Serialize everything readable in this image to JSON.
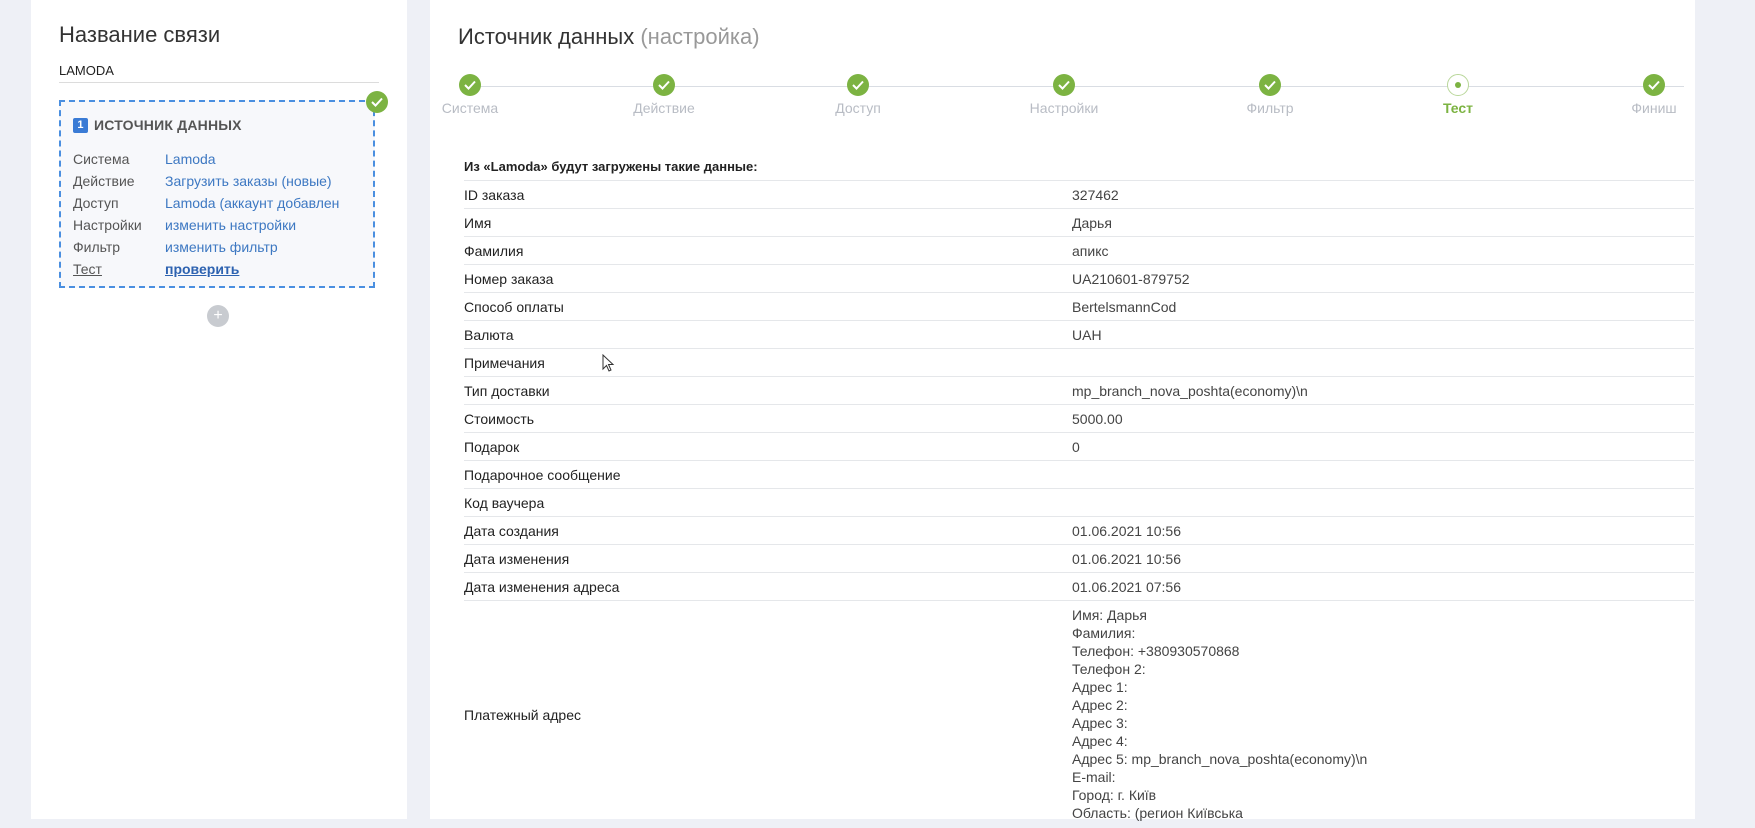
{
  "left": {
    "title": "Название связи",
    "connection_name": "LAMODA",
    "card": {
      "number": "1",
      "header": "ИСТОЧНИК ДАННЫХ",
      "rows": [
        {
          "label": "Система",
          "value": "Lamoda"
        },
        {
          "label": "Действие",
          "value": "Загрузить заказы (новые)"
        },
        {
          "label": "Доступ",
          "value": "Lamoda (аккаунт добавлен"
        },
        {
          "label": "Настройки",
          "value": "изменить настройки"
        },
        {
          "label": "Фильтр",
          "value": "изменить фильтр"
        },
        {
          "label": "Тест",
          "value": "проверить"
        }
      ]
    },
    "add_label": "+"
  },
  "main": {
    "title": "Источник данных",
    "title_sub": "(настройка)",
    "steps": [
      {
        "label": "Система",
        "state": "done"
      },
      {
        "label": "Действие",
        "state": "done"
      },
      {
        "label": "Доступ",
        "state": "done"
      },
      {
        "label": "Настройки",
        "state": "done"
      },
      {
        "label": "Фильтр",
        "state": "done"
      },
      {
        "label": "Тест",
        "state": "current"
      },
      {
        "label": "Финиш",
        "state": "done"
      }
    ],
    "data_heading": "Из «Lamoda» будут загружены такие данные:",
    "rows": [
      {
        "key": "ID заказа",
        "value": "327462"
      },
      {
        "key": "Имя",
        "value": "Дарья"
      },
      {
        "key": "Фамилия",
        "value": "апикс"
      },
      {
        "key": "Номер заказа",
        "value": "UA210601-879752"
      },
      {
        "key": "Способ оплаты",
        "value": "BertelsmannCod"
      },
      {
        "key": "Валюта",
        "value": "UAH"
      },
      {
        "key": "Примечания",
        "value": ""
      },
      {
        "key": "Тип доставки",
        "value": "mp_branch_nova_poshta(economy)\\n"
      },
      {
        "key": "Стоимость",
        "value": "5000.00"
      },
      {
        "key": "Подарок",
        "value": "0"
      },
      {
        "key": "Подарочное сообщение",
        "value": ""
      },
      {
        "key": "Код ваучера",
        "value": ""
      },
      {
        "key": "Дата создания",
        "value": "01.06.2021 10:56"
      },
      {
        "key": "Дата изменения",
        "value": "01.06.2021 10:56"
      },
      {
        "key": "Дата изменения адреса",
        "value": "01.06.2021 07:56"
      }
    ],
    "billing": {
      "key": "Платежный адрес",
      "lines": [
        "Имя: Дарья",
        "Фамилия:",
        "Телефон: +380930570868",
        "Телефон 2:",
        "Адрес 1:",
        "Адрес 2:",
        "Адрес 3:",
        "Адрес 4:",
        "Адрес 5: mp_branch_nova_poshta(economy)\\n",
        "E-mail:",
        "Город: г. Київ",
        "Область: (регион Київська"
      ]
    }
  },
  "colors": {
    "accent_green": "#7cb342",
    "link_blue": "#3d78c2",
    "dashed_border": "#4a8fe0"
  }
}
